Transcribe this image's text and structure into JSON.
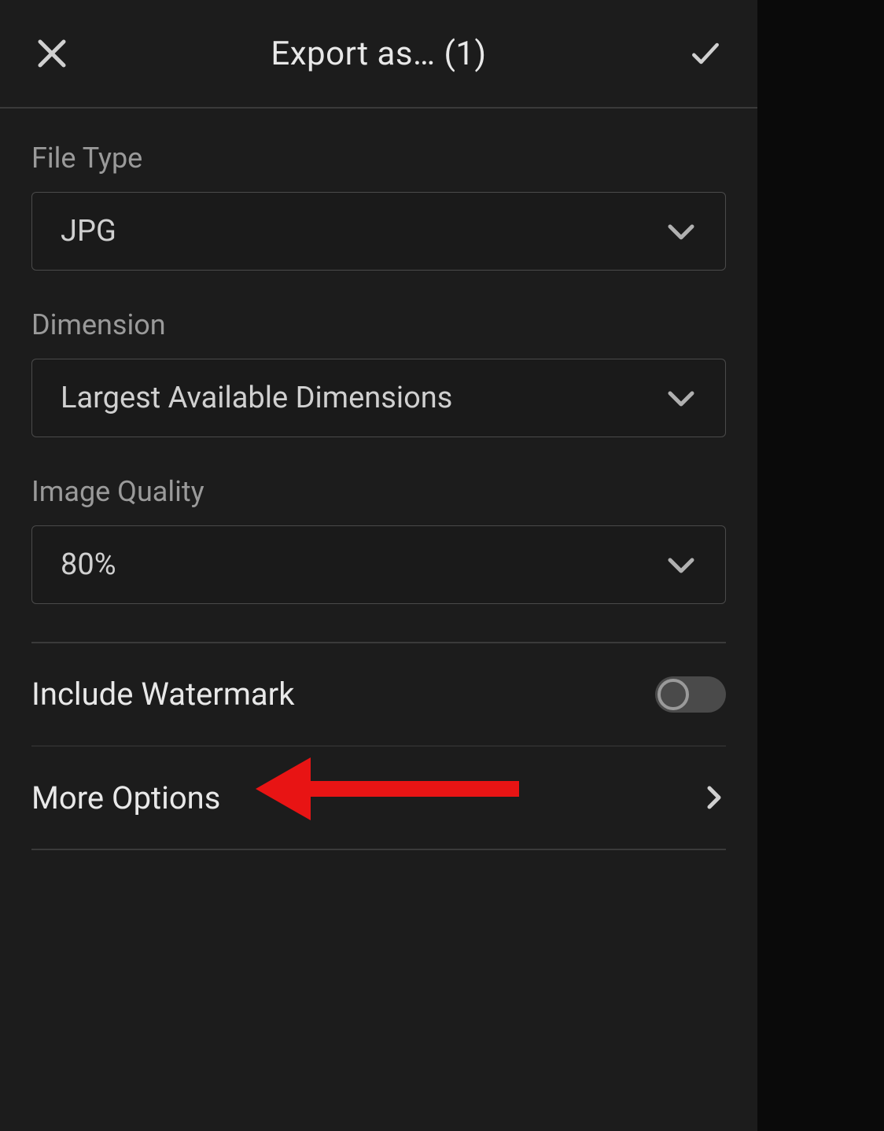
{
  "header": {
    "title": "Export as… (1)"
  },
  "fields": {
    "fileType": {
      "label": "File Type",
      "value": "JPG"
    },
    "dimension": {
      "label": "Dimension",
      "value": "Largest Available Dimensions"
    },
    "imageQuality": {
      "label": "Image Quality",
      "value": "80%"
    }
  },
  "watermark": {
    "label": "Include Watermark",
    "enabled": false
  },
  "moreOptions": {
    "label": "More Options"
  }
}
